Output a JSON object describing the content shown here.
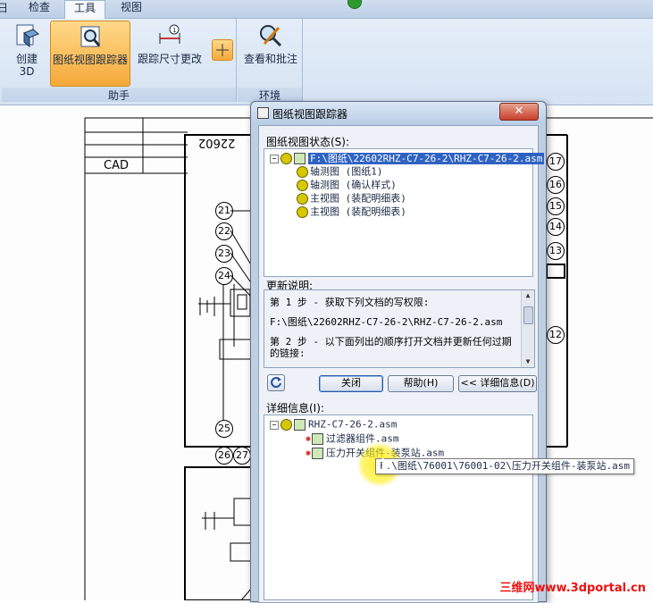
{
  "ribbon": {
    "tabs": [
      {
        "label": "检查"
      },
      {
        "label": "工具"
      },
      {
        "label": "视图"
      }
    ],
    "leading_tab_fragment": "日",
    "buttons": {
      "create3d": "创建\n3D",
      "tracker": "图纸视图跟踪器",
      "dim_tracker": "跟踪尺寸更改",
      "view_annotate": "查看和批注"
    },
    "groups": {
      "assistant": "助手",
      "environment": "环境"
    }
  },
  "drawing": {
    "cad_label": "CAD",
    "part_number": "22602",
    "balloons_left": [
      "21",
      "22",
      "23",
      "24",
      "25",
      "26",
      "27"
    ],
    "balloons_right": [
      "17",
      "16",
      "15",
      "14",
      "13",
      "12"
    ]
  },
  "dialog": {
    "title": "图纸视图跟踪器",
    "close_glyph": "✕",
    "status_label": "图纸视图状态(S):",
    "status_tree": {
      "root": "F:\\图纸\\22602RHZ-C7-26-2\\RHZ-C7-26-2.asm",
      "children": [
        "轴测图 (图纸1)",
        "轴测图 (确认样式)",
        "主视图 (装配明细表)",
        "主视图 (装配明细表)"
      ]
    },
    "update_label": "更新说明:",
    "update_lines": [
      "第 1 步 - 获取下列文档的写权限:",
      "F:\\图纸\\22602RHZ-C7-26-2\\RHZ-C7-26-2.asm",
      "第 2 步 - 以下面列出的顺序打开文档并更新任何过期",
      "的链接:"
    ],
    "buttons": {
      "close": "关闭",
      "help": "帮助(H)",
      "details": "<< 详细信息(D)"
    },
    "detail_label": "详细信息(I):",
    "detail_tree": {
      "root": "RHZ-C7-26-2.asm",
      "children": [
        "过滤器组件.asm",
        "压力开关组件-装泵站.asm"
      ]
    },
    "tooltip": "F:\\图纸\\76001\\76001-02\\压力开关组件-装泵站.asm"
  },
  "watermark": "三维网www.3dportal.cn"
}
